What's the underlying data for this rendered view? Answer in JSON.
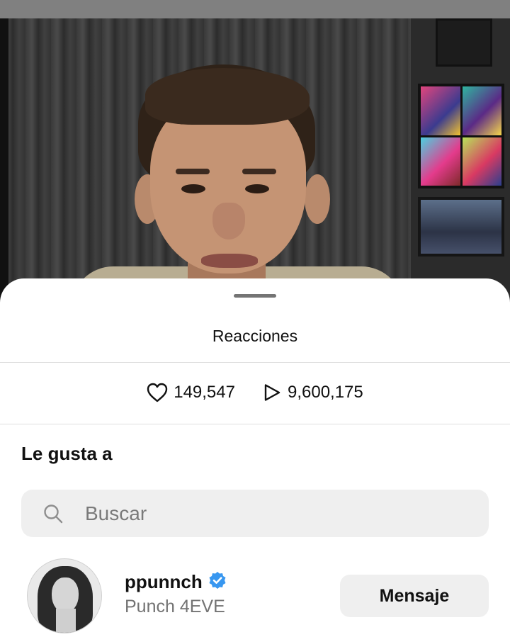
{
  "sheet": {
    "title": "Reacciones",
    "likes": {
      "icon": "heart-icon",
      "count": "149,547"
    },
    "plays": {
      "icon": "play-icon",
      "count": "9,600,175"
    },
    "section_title": "Le gusta a",
    "search": {
      "icon": "search-icon",
      "placeholder": "Buscar"
    },
    "users": [
      {
        "username": "ppunnch",
        "verified": true,
        "full_name": "Punch 4EVE",
        "action_label": "Mensaje"
      }
    ]
  },
  "colors": {
    "verified_badge": "#3897f0",
    "sheet_background": "#ffffff",
    "button_background": "#efefef",
    "secondary_text": "#737373"
  }
}
